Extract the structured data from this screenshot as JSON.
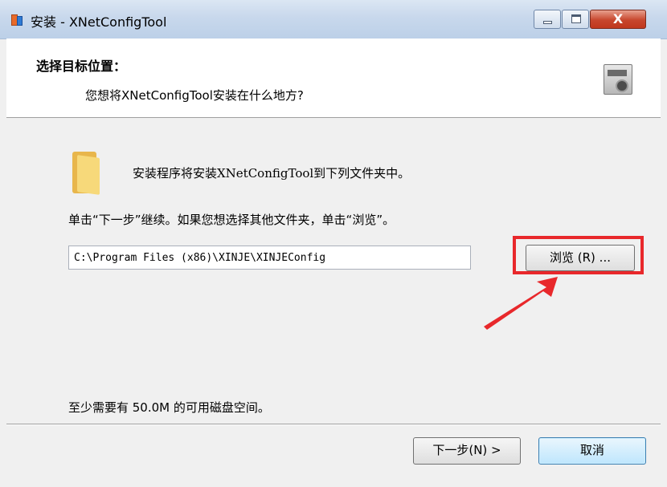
{
  "window": {
    "title": "安装 - XNetConfigTool",
    "close_symbol": "X"
  },
  "header": {
    "title": "选择目标位置：",
    "subtitle": "您想将XNetConfigTool安装在什么地方?"
  },
  "main": {
    "install_info": "安装程序将安装XNetConfigTool到下列文件夹中。",
    "instruction": "单击“下一步”继续。如果您想选择其他文件夹，单击“浏览”。",
    "path_value": "C:\\Program Files (x86)\\XINJE\\XINJEConfig",
    "browse_label": "浏览 (R) ...",
    "disk_space": "至少需要有 50.0M 的可用磁盘空间。"
  },
  "footer": {
    "next_label": "下一步(N) >",
    "cancel_label": "取消"
  },
  "colors": {
    "highlight": "#e8282b",
    "titlebar": "#c8d8ec",
    "cancel_bg": "#bee6fd"
  },
  "icons": [
    "app-icon",
    "minimize-icon",
    "maximize-icon",
    "close-icon",
    "folder-icon",
    "setup-graphic-icon",
    "arrow-annotation"
  ]
}
